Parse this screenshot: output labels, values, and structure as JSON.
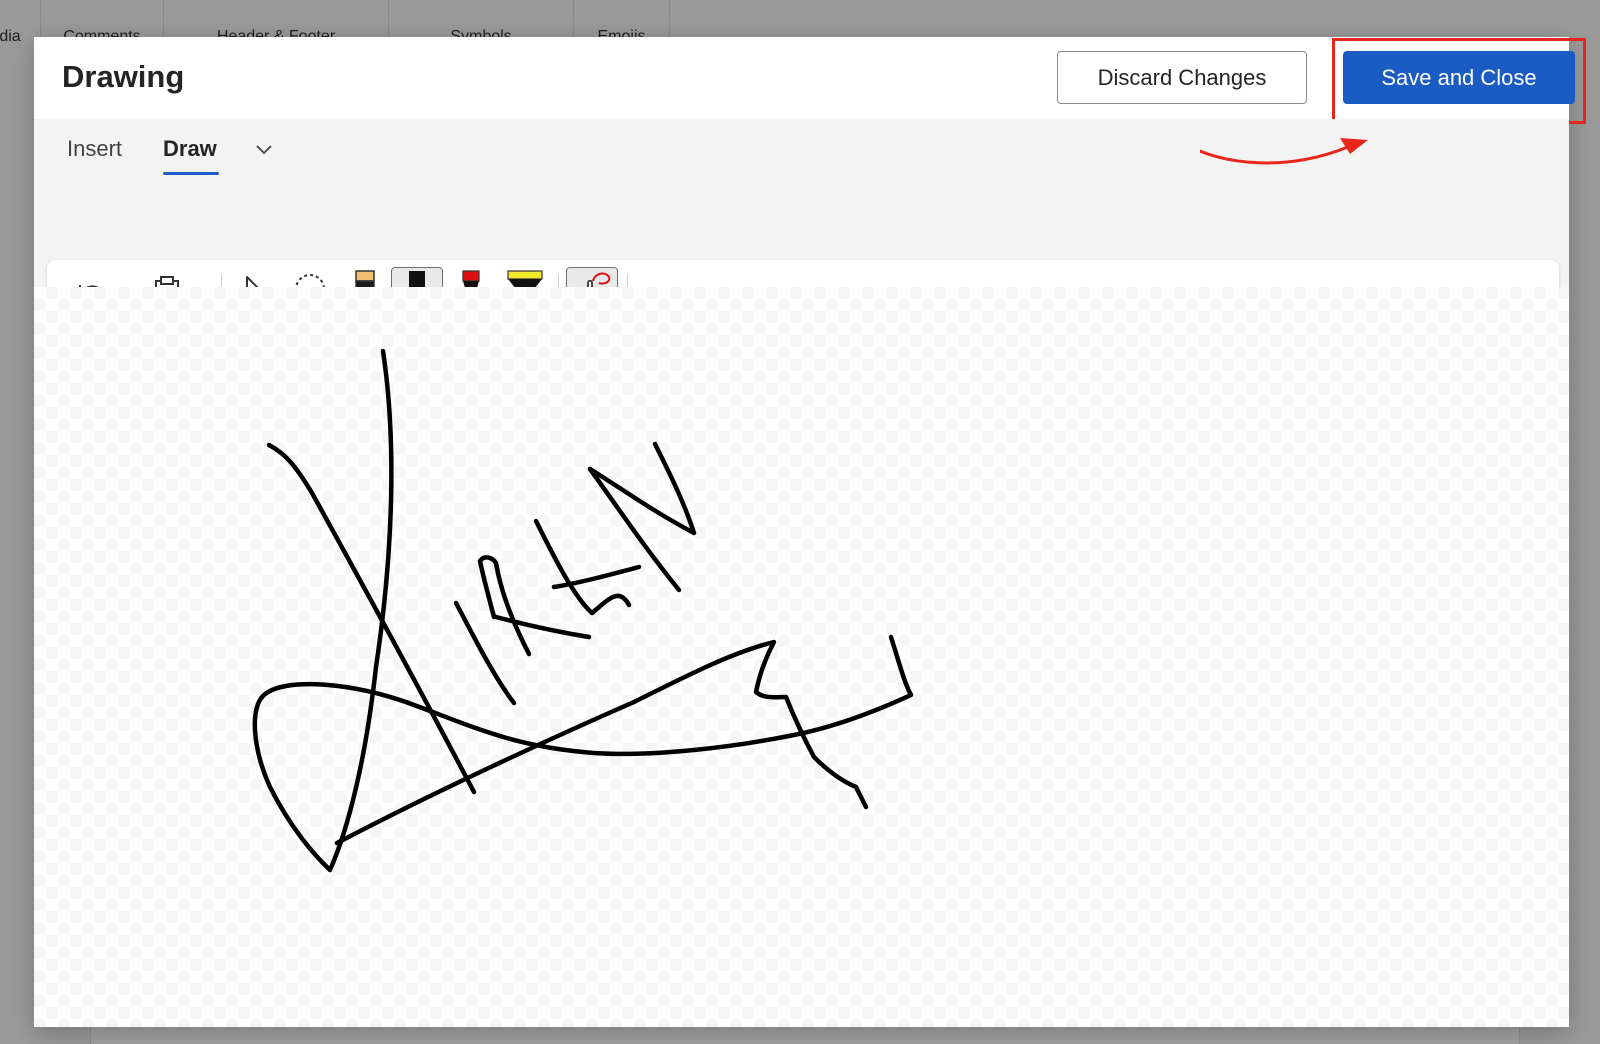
{
  "background_ribbon": {
    "tabs": [
      "dia",
      "Comments",
      "Header & Footer",
      "Symbols",
      "Emojis"
    ]
  },
  "dialog": {
    "title": "Drawing",
    "discard_label": "Discard Changes",
    "save_label": "Save and Close",
    "tabs": [
      {
        "label": "Insert",
        "active": false
      },
      {
        "label": "Draw",
        "active": true
      }
    ],
    "toolbar": {
      "tools": [
        {
          "name": "undo-icon",
          "has_dropdown": true
        },
        {
          "name": "clipboard-icon",
          "has_dropdown": true
        },
        {
          "name": "select-pointer-icon"
        },
        {
          "name": "lasso-select-icon"
        },
        {
          "name": "eraser-icon"
        },
        {
          "name": "black-pen-icon",
          "selected": true,
          "has_dropdown": true
        },
        {
          "name": "red-pen-icon"
        },
        {
          "name": "yellow-highlighter-icon"
        },
        {
          "name": "draw-with-touch-icon",
          "selected": true
        }
      ]
    }
  },
  "colors": {
    "accent_blue": "#1a5bc4",
    "annotation_red": "#e8261c",
    "ink": "#000000"
  }
}
